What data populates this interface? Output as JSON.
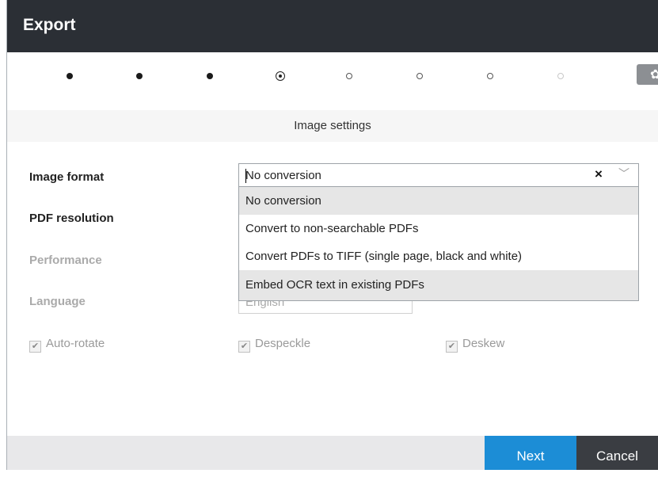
{
  "header": {
    "title": "Export"
  },
  "steps": [
    {
      "state": "done"
    },
    {
      "state": "done"
    },
    {
      "state": "done"
    },
    {
      "state": "current"
    },
    {
      "state": "future"
    },
    {
      "state": "future"
    },
    {
      "state": "future"
    },
    {
      "state": "future-faint"
    }
  ],
  "settings_icon": "gear-icon",
  "section": {
    "title": "Image settings"
  },
  "form": {
    "image_format_label": "Image format",
    "image_format_value": "No conversion",
    "clear_icon": "×",
    "pdf_resolution_label": "PDF resolution",
    "performance_label": "Performance",
    "language_label": "Language",
    "language_value": "English"
  },
  "dropdown": {
    "options": [
      "No conversion",
      "Convert to non-searchable PDFs",
      "Convert PDFs to TIFF (single page, black and white)",
      "Embed OCR text in existing PDFs"
    ],
    "selected_index": 0,
    "hovered_index": 3
  },
  "checkboxes": {
    "auto_rotate": {
      "label": "Auto-rotate",
      "checked": true,
      "enabled": false
    },
    "despeckle": {
      "label": "Despeckle",
      "checked": true,
      "enabled": false
    },
    "deskew": {
      "label": "Deskew",
      "checked": true,
      "enabled": false
    }
  },
  "footer": {
    "next_label": "Next",
    "cancel_label": "Cancel"
  },
  "colors": {
    "header_bg": "#2b2f35",
    "primary": "#1c8dd6",
    "cancel_bg": "#3a3d42"
  }
}
